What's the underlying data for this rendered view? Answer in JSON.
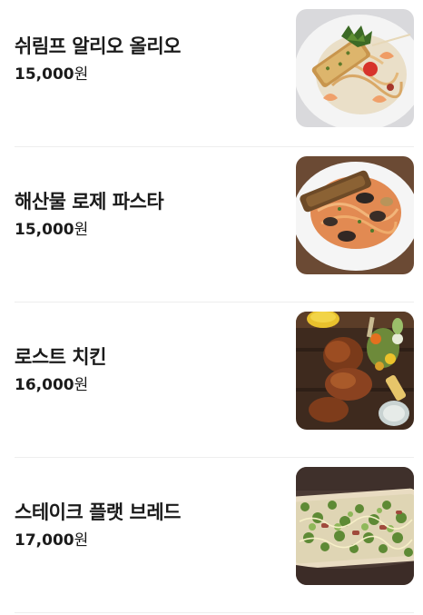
{
  "menu": {
    "items": [
      {
        "name": "쉬림프 알리오 올리오",
        "price": "15,000",
        "unit": "원"
      },
      {
        "name": "해산물 로제 파스타",
        "price": "15,000",
        "unit": "원"
      },
      {
        "name": "로스트 치킨",
        "price": "16,000",
        "unit": "원"
      },
      {
        "name": "스테이크 플랫 브레드",
        "price": "17,000",
        "unit": "원"
      }
    ]
  }
}
